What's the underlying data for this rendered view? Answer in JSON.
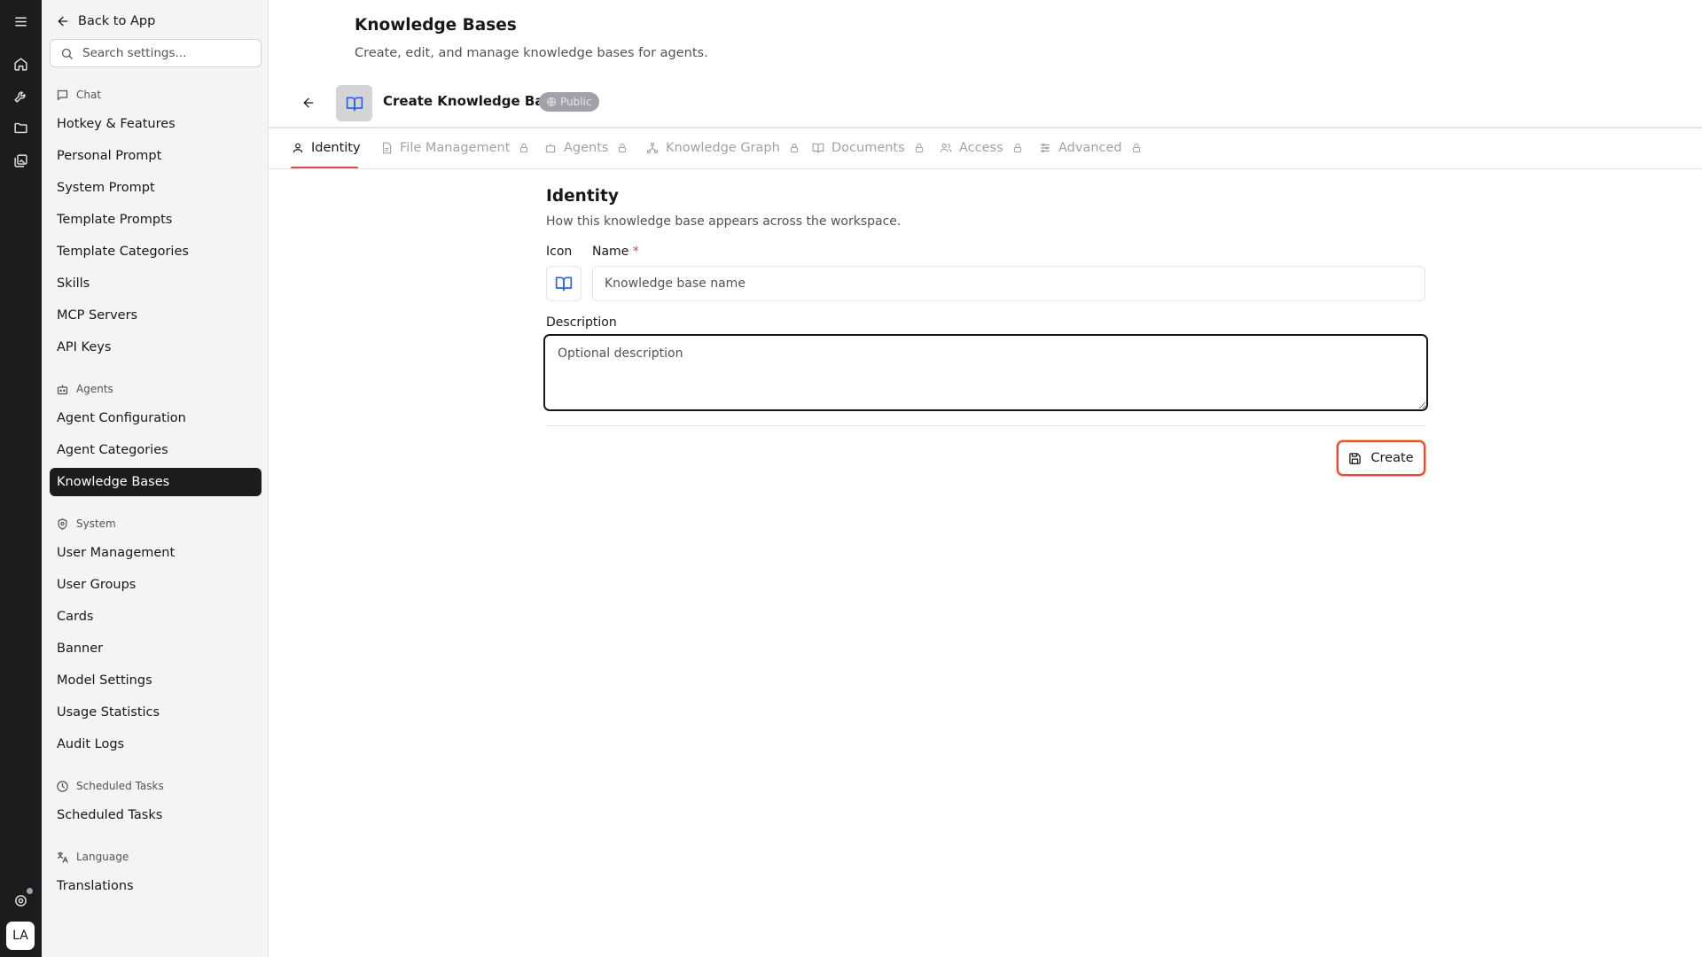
{
  "sidebar": {
    "back_label": "Back to App",
    "search_placeholder": "Search settings...",
    "sections": {
      "chat": "Chat",
      "agents": "Agents",
      "system": "System",
      "scheduled": "Scheduled Tasks",
      "language": "Language"
    },
    "items": {
      "hotkey": "Hotkey & Features",
      "personal_prompt": "Personal Prompt",
      "system_prompt": "System Prompt",
      "template_prompts": "Template Prompts",
      "template_categories": "Template Categories",
      "skills": "Skills",
      "mcp_servers": "MCP Servers",
      "api_keys": "API Keys",
      "agent_configuration": "Agent Configuration",
      "agent_categories": "Agent Categories",
      "knowledge_bases": "Knowledge Bases",
      "user_management": "User Management",
      "user_groups": "User Groups",
      "cards": "Cards",
      "banner": "Banner",
      "model_settings": "Model Settings",
      "usage_statistics": "Usage Statistics",
      "audit_logs": "Audit Logs",
      "scheduled_tasks": "Scheduled Tasks",
      "translations": "Translations"
    },
    "active_item": "Knowledge Bases"
  },
  "rail": {
    "avatar_initials": "LA"
  },
  "header": {
    "title": "Knowledge Bases",
    "subtitle": "Create, edit, and manage knowledge bases for agents."
  },
  "editor": {
    "title": "Create Knowledge Base",
    "visibility_badge": "Public"
  },
  "tabs": {
    "identity": "Identity",
    "file_management": "File Management",
    "agents": "Agents",
    "knowledge_graph": "Knowledge Graph",
    "documents": "Documents",
    "access": "Access",
    "advanced": "Advanced",
    "active": "Identity"
  },
  "form": {
    "section_title": "Identity",
    "section_description": "How this knowledge base appears across the workspace.",
    "icon_label": "Icon",
    "name_label": "Name",
    "name_required_mark": "*",
    "name_placeholder": "Knowledge base name",
    "name_value": "",
    "description_label": "Description",
    "description_placeholder": "Optional description",
    "description_value": "",
    "create_label": "Create"
  },
  "colors": {
    "accent": "#ef4444",
    "sidebar_active_bg": "#1c1c1f",
    "icon_blue": "#2563eb"
  }
}
